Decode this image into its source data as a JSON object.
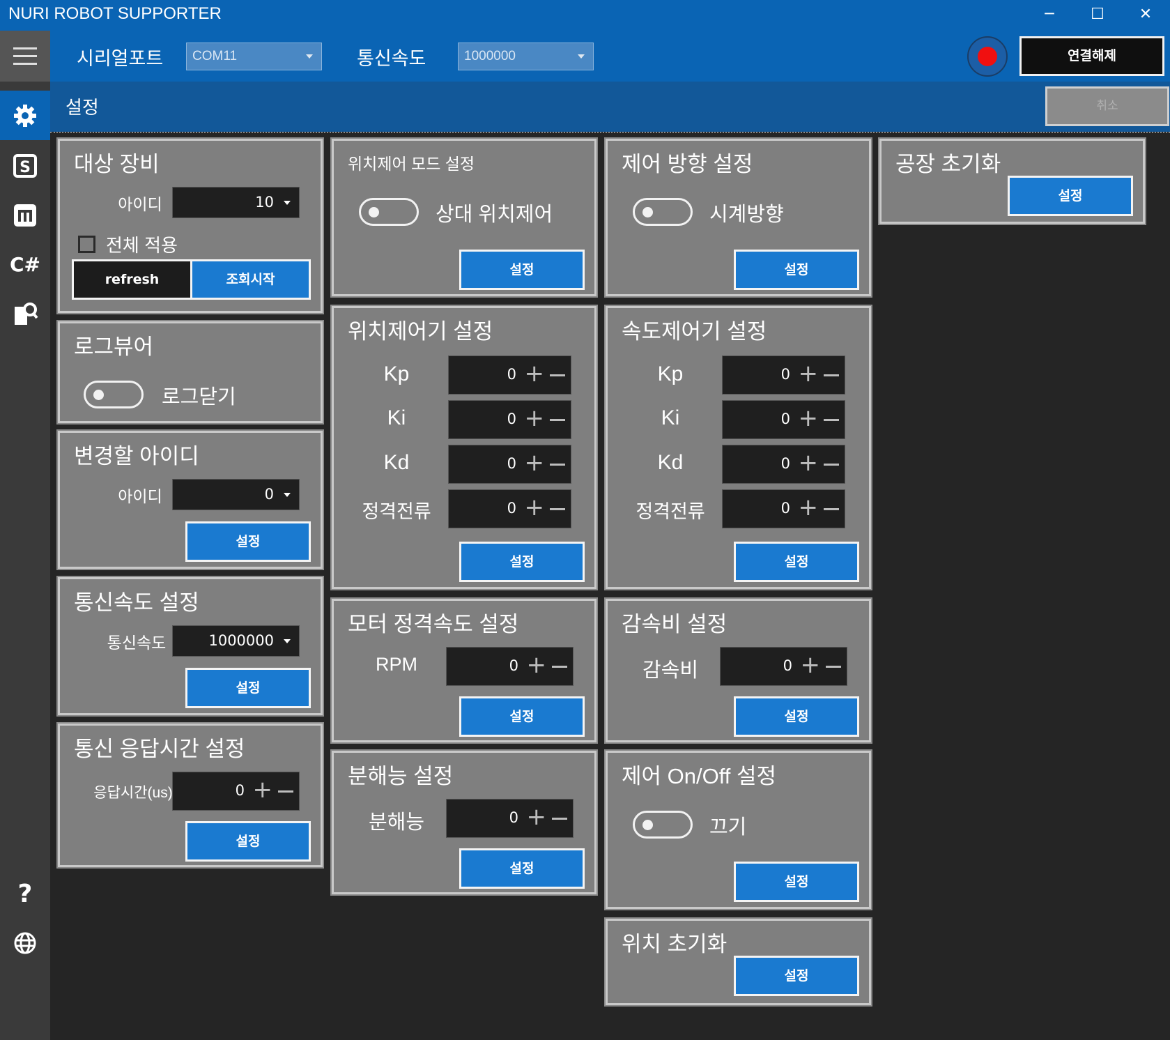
{
  "app": {
    "title": "NURI ROBOT SUPPORTER"
  },
  "window": {
    "minimize": "─",
    "maximize": "☐",
    "close": "✕"
  },
  "toolbar": {
    "serial_label": "시리얼포트",
    "serial_value": "COM11",
    "baud_label": "통신속도",
    "baud_value": "1000000",
    "disconnect_label": "연결해제"
  },
  "sidebar": {
    "items": [
      {
        "icon": "gear-icon"
      },
      {
        "icon": "s-box-icon"
      },
      {
        "icon": "m-box-icon"
      },
      {
        "icon": "csharp-icon",
        "label": "C#"
      },
      {
        "icon": "document-search-icon"
      },
      {
        "icon": "help-icon",
        "label": "?"
      },
      {
        "icon": "globe-icon"
      }
    ]
  },
  "header": {
    "title": "설정",
    "cancel_label": "취소"
  },
  "panels": {
    "target": {
      "title": "대상 장비",
      "id_label": "아이디",
      "id_value": "10",
      "apply_all": "전체 적용",
      "refresh": "refresh",
      "start": "조회시작"
    },
    "logviewer": {
      "title": "로그뷰어",
      "toggle_label": "로그닫기"
    },
    "change_id": {
      "title": "변경할 아이디",
      "id_label": "아이디",
      "id_value": "0",
      "set": "설정"
    },
    "baud": {
      "title": "통신속도 설정",
      "label": "통신속도",
      "value": "1000000",
      "set": "설정"
    },
    "resp": {
      "title": "통신 응답시간 설정",
      "label": "응답시간(us)",
      "value": "0",
      "set": "설정"
    },
    "pos_mode": {
      "title": "위치제어 모드 설정",
      "toggle_label": "상대 위치제어",
      "set": "설정"
    },
    "pos_ctrl": {
      "title": "위치제어기 설정",
      "kp": "Kp",
      "ki": "Ki",
      "kd": "Kd",
      "current": "정격전류",
      "kp_val": "0",
      "ki_val": "0",
      "kd_val": "0",
      "current_val": "0",
      "set": "설정"
    },
    "motor_speed": {
      "title": "모터 정격속도 설정",
      "label": "RPM",
      "value": "0",
      "set": "설정"
    },
    "resolution": {
      "title": "분해능 설정",
      "label": "분해능",
      "value": "0",
      "set": "설정"
    },
    "direction": {
      "title": "제어 방향 설정",
      "toggle_label": "시계방향",
      "set": "설정"
    },
    "speed_ctrl": {
      "title": "속도제어기 설정",
      "kp": "Kp",
      "ki": "Ki",
      "kd": "Kd",
      "current": "정격전류",
      "kp_val": "0",
      "ki_val": "0",
      "kd_val": "0",
      "current_val": "0",
      "set": "설정"
    },
    "reduction": {
      "title": "감속비 설정",
      "label": "감속비",
      "value": "0",
      "set": "설정"
    },
    "onoff": {
      "title": "제어 On/Off 설정",
      "toggle_label": "끄기",
      "set": "설정"
    },
    "pos_reset": {
      "title": "위치 초기화",
      "set": "설정"
    },
    "factory": {
      "title": "공장 초기화",
      "set": "설정"
    }
  },
  "colors": {
    "accent": "#0a64b4",
    "button": "#1a7ad0",
    "panel": "#7f7f7f",
    "record": "#f01010"
  }
}
